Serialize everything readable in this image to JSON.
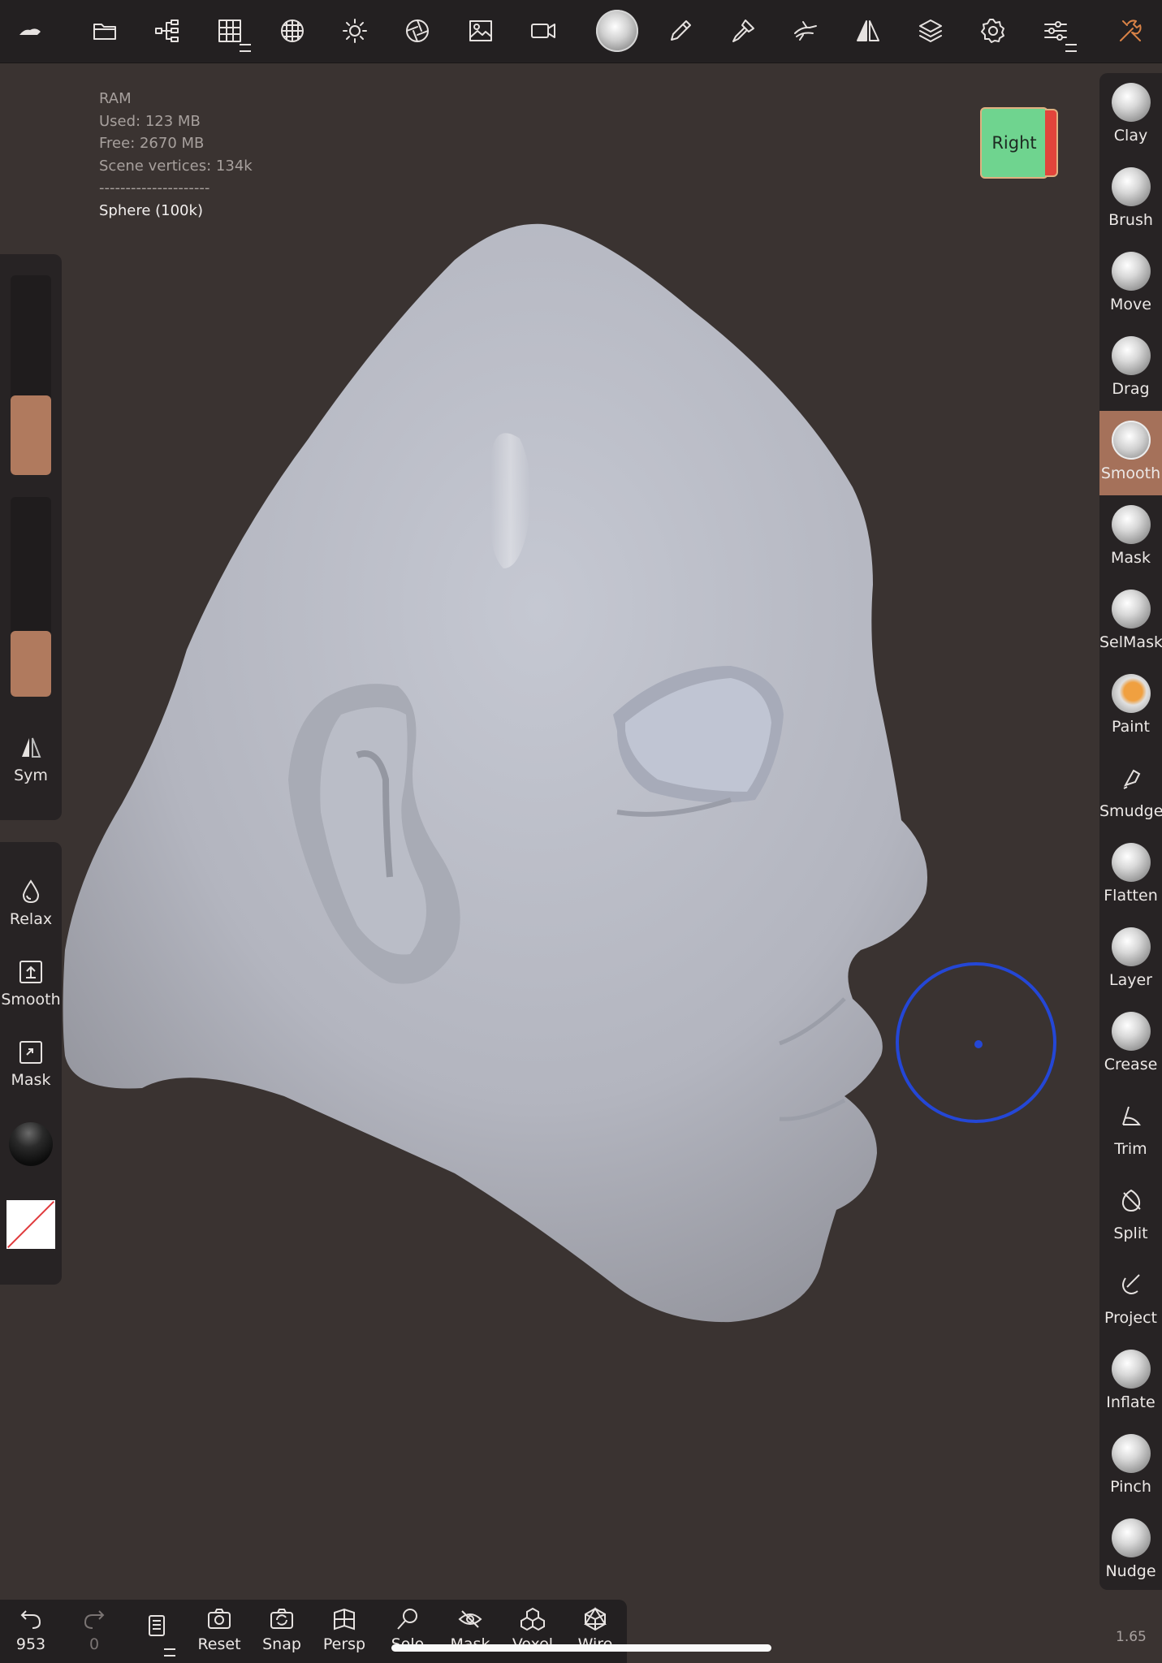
{
  "toolbar": {
    "icons": [
      "logo-icon",
      "folder-icon",
      "scene-tree-icon",
      "grid-icon",
      "sphere-icon",
      "sun-icon",
      "aperture-icon",
      "image-icon",
      "camera-icon",
      "matcap-icon",
      "pen-icon",
      "brush-icon",
      "hand-icon",
      "symmetry-icon",
      "layers-icon",
      "settings-icon",
      "sliders-icon",
      "tools-icon"
    ]
  },
  "info": {
    "ram": "RAM",
    "used": "Used: 123 MB",
    "free": "Free: 2670 MB",
    "vertices": "Scene vertices: 134k",
    "separator": "---------------------",
    "object": "Sphere (100k)"
  },
  "view_cube": {
    "front_label": "Right"
  },
  "left_panel": {
    "radius_level": 0.4,
    "intensity_level": 0.33,
    "sym_label": "Sym",
    "relax_label": "Relax",
    "smooth_label": "Smooth",
    "mask_label": "Mask"
  },
  "tools": [
    {
      "label": "Clay"
    },
    {
      "label": "Brush"
    },
    {
      "label": "Move"
    },
    {
      "label": "Drag"
    },
    {
      "label": "Smooth",
      "active": true
    },
    {
      "label": "Mask"
    },
    {
      "label": "SelMask"
    },
    {
      "label": "Paint"
    },
    {
      "label": "Smudge"
    },
    {
      "label": "Flatten"
    },
    {
      "label": "Layer"
    },
    {
      "label": "Crease"
    },
    {
      "label": "Trim"
    },
    {
      "label": "Split"
    },
    {
      "label": "Project"
    },
    {
      "label": "Inflate"
    },
    {
      "label": "Pinch"
    },
    {
      "label": "Nudge"
    }
  ],
  "bottom_bar": {
    "undo_count": "953",
    "redo_count": "0",
    "reset_label": "Reset",
    "snap_label": "Snap",
    "persp_label": "Persp",
    "solo_label": "Solo",
    "mask_label": "Mask",
    "voxel_label": "Voxel",
    "wire_label": "Wire"
  },
  "zoom_value": "1.65",
  "colors": {
    "accent": "#a5715a",
    "background": "#3a3331",
    "cursor": "#2447d6",
    "model": "#b4b6bf"
  }
}
